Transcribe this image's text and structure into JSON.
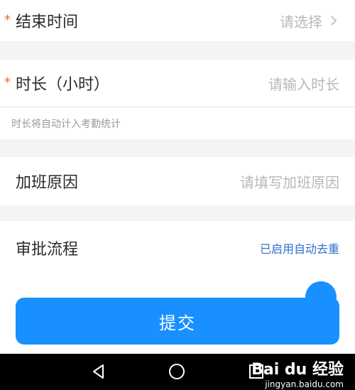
{
  "form": {
    "end_time": {
      "required_mark": "*",
      "label": "结束时间",
      "placeholder": "请选择"
    },
    "duration": {
      "required_mark": "*",
      "label": "时长（小时）",
      "placeholder": "请输入时长",
      "hint": "时长将自动计入考勤统计"
    },
    "reason": {
      "label": "加班原因",
      "placeholder": "请填写加班原因"
    },
    "approval": {
      "label": "审批流程",
      "status": "已启用自动去重"
    }
  },
  "actions": {
    "submit_label": "提交"
  },
  "system_nav": {
    "icons": [
      "back-icon",
      "home-icon",
      "recents-icon"
    ]
  },
  "watermark": {
    "brand": "Bai du 经验",
    "site": "jingyan.baidu.com"
  },
  "colors": {
    "accent": "#1890ff",
    "required": "#f0622d",
    "link": "#2f6fcc",
    "background": "#f3f4f6"
  }
}
